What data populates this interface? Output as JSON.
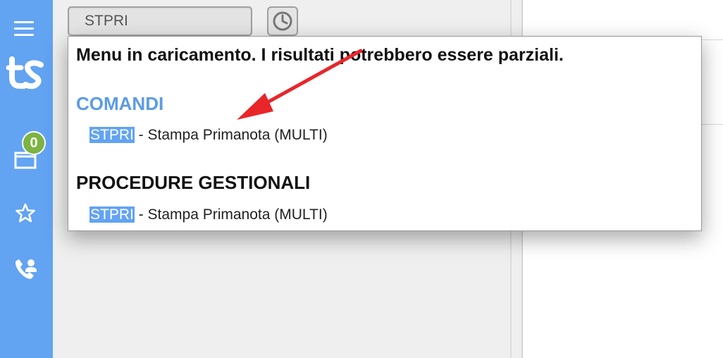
{
  "sidebar": {
    "menu_icon": "hamburger-icon",
    "logo_text": "ts",
    "notifications_badge": "0",
    "icons": [
      "hamburger-icon",
      "ts-logo",
      "window-icon",
      "star-icon",
      "phone-user-icon"
    ],
    "accent_color": "#62a3f2",
    "badge_color": "#7cb342"
  },
  "search": {
    "value": "STPRI",
    "history_icon": "clock-icon"
  },
  "dropdown": {
    "loading_message": "Menu in caricamento. I risultati potrebbero essere parziali.",
    "sections": [
      {
        "title": "COMANDI",
        "title_color": "#5b9be6",
        "items": [
          {
            "match": "STPRI",
            "rest": " - Stampa Primanota (MULTI)"
          }
        ]
      },
      {
        "title": "PROCEDURE GESTIONALI",
        "title_color": "#111111",
        "items": [
          {
            "match": "STPRI",
            "rest": " - Stampa Primanota (MULTI)"
          }
        ]
      }
    ],
    "highlight_color": "#62a3f2"
  },
  "annotation": {
    "arrow_color": "#e8262a"
  }
}
